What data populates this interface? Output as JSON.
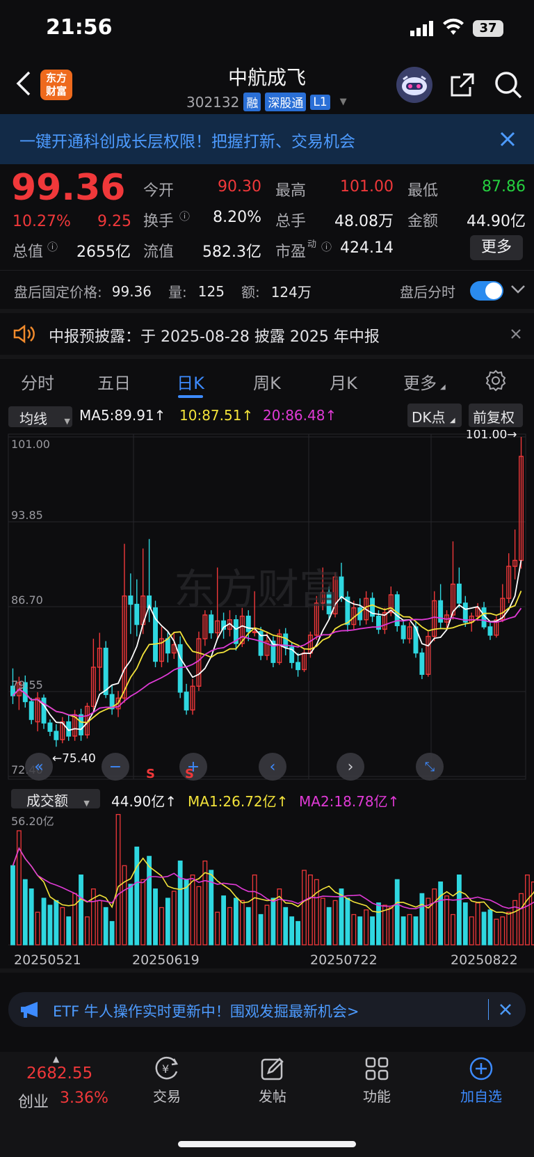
{
  "status_bar": {
    "time": "21:56",
    "battery": "37"
  },
  "header": {
    "title": "中航成飞",
    "code": "302132",
    "tags": [
      "融",
      "深股通",
      "L1"
    ],
    "logo_text": [
      "东方",
      "财富"
    ]
  },
  "banner": {
    "text": "一键开通科创成长层权限！把握打新、交易机会"
  },
  "quote": {
    "price": "99.36",
    "change_pct": "10.27%",
    "change_amt": "9.25",
    "rows": [
      [
        {
          "label": "今开",
          "value": "90.30",
          "color": "red"
        },
        {
          "label": "最高",
          "value": "101.00",
          "color": "red"
        },
        {
          "label": "最低",
          "value": "87.86",
          "color": "green"
        }
      ],
      [
        {
          "label": "换手",
          "value": "8.20%",
          "color": "white"
        },
        {
          "label": "总手",
          "value": "48.08万",
          "color": "white"
        },
        {
          "label": "金额",
          "value": "44.90亿",
          "color": "white"
        }
      ],
      [
        {
          "label": "流值",
          "value": "582.3亿",
          "color": "white"
        },
        {
          "label": "市盈",
          "value": "424.14",
          "color": "white"
        }
      ]
    ],
    "total_value_label": "总值",
    "total_value": "2655亿",
    "pe_sup": "动",
    "more_label": "更多"
  },
  "after_hours": {
    "price_label": "盘后固定价格:",
    "price": "99.36",
    "vol_label": "量:",
    "vol": "125",
    "amt_label": "额:",
    "amt": "124万",
    "timeshare_label": "盘后分时"
  },
  "notice": {
    "text": "中报预披露：于 2025-08-28 披露 2025 年中报"
  },
  "tabs": [
    "分时",
    "五日",
    "日K",
    "周K",
    "月K",
    "更多"
  ],
  "active_tab": "日K",
  "ma_bar": {
    "selector": "均线",
    "ma5": "MA5:89.91↑",
    "ma10": "10:87.51↑",
    "ma20": "20:86.48↑",
    "dk": "DK点",
    "adjust": "前复权"
  },
  "chart_data": [
    {
      "type": "candlestick",
      "y_ticks": [
        "101.00",
        "93.85",
        "86.70",
        "79.55",
        "72.40"
      ],
      "ylim": [
        72.4,
        101.0
      ],
      "annotations": [
        "101.00→",
        "←75.40"
      ],
      "series_colors": {
        "up": "#f0383a",
        "down": "#2fd7e0",
        "ma5": "#ffffff",
        "ma10": "#f3e33a",
        "ma20": "#e03ad6"
      },
      "marks": [
        "S",
        "S"
      ],
      "candles": [
        [
          80.0,
          81.5,
          78.5,
          79.2
        ],
        [
          79.2,
          80.8,
          78.0,
          80.3
        ],
        [
          80.3,
          80.9,
          78.2,
          78.7
        ],
        [
          78.7,
          79.0,
          76.8,
          77.2
        ],
        [
          77.0,
          79.5,
          76.2,
          79.0
        ],
        [
          79.0,
          79.3,
          76.4,
          76.9
        ],
        [
          76.9,
          77.2,
          75.8,
          76.2
        ],
        [
          76.2,
          76.8,
          74.9,
          75.5
        ],
        [
          75.5,
          77.4,
          75.2,
          77.0
        ],
        [
          77.0,
          77.6,
          75.4,
          75.8
        ],
        [
          75.8,
          78.0,
          75.4,
          77.6
        ],
        [
          77.6,
          78.1,
          75.4,
          75.9
        ],
        [
          75.9,
          78.6,
          75.6,
          78.3
        ],
        [
          78.3,
          84.0,
          78.0,
          81.6
        ],
        [
          81.6,
          84.5,
          79.6,
          83.2
        ],
        [
          83.2,
          83.8,
          79.0,
          79.3
        ],
        [
          79.3,
          80.1,
          77.6,
          78.1
        ],
        [
          78.1,
          79.6,
          77.4,
          79.0
        ],
        [
          79.0,
          92.0,
          78.6,
          87.6
        ],
        [
          87.6,
          89.5,
          84.4,
          86.9
        ],
        [
          86.9,
          89.0,
          84.2,
          85.2
        ],
        [
          85.2,
          91.6,
          84.4,
          87.6
        ],
        [
          87.6,
          92.4,
          85.4,
          86.6
        ],
        [
          86.6,
          87.2,
          81.6,
          82.1
        ],
        [
          82.1,
          85.0,
          81.6,
          84.0
        ],
        [
          84.0,
          84.6,
          82.0,
          82.8
        ],
        [
          82.8,
          84.5,
          82.3,
          83.5
        ],
        [
          83.5,
          84.2,
          79.0,
          79.5
        ],
        [
          79.5,
          80.2,
          77.6,
          78.0
        ],
        [
          78.0,
          80.6,
          77.6,
          80.0
        ],
        [
          80.0,
          84.6,
          79.6,
          84.0
        ],
        [
          84.0,
          86.4,
          83.4,
          86.0
        ],
        [
          86.0,
          86.4,
          84.0,
          84.5
        ],
        [
          84.5,
          90.0,
          84.0,
          85.5
        ],
        [
          85.5,
          86.2,
          84.0,
          84.8
        ],
        [
          84.8,
          86.4,
          84.2,
          85.6
        ],
        [
          85.6,
          86.0,
          83.0,
          83.6
        ],
        [
          83.6,
          86.6,
          83.3,
          85.9
        ],
        [
          85.9,
          86.4,
          83.8,
          84.6
        ],
        [
          84.6,
          88.0,
          84.2,
          84.6
        ],
        [
          84.6,
          85.0,
          82.2,
          82.6
        ],
        [
          82.6,
          84.6,
          82.2,
          83.8
        ],
        [
          83.8,
          84.2,
          81.6,
          82.0
        ],
        [
          82.0,
          84.8,
          81.8,
          84.4
        ],
        [
          84.4,
          84.9,
          82.6,
          83.3
        ],
        [
          83.3,
          83.7,
          81.5,
          82.0
        ],
        [
          82.0,
          82.8,
          80.8,
          81.4
        ],
        [
          81.4,
          83.2,
          81.2,
          82.8
        ],
        [
          82.8,
          84.6,
          82.4,
          84.3
        ],
        [
          84.3,
          87.6,
          83.9,
          87.0
        ],
        [
          87.0,
          90.0,
          86.4,
          87.9
        ],
        [
          87.9,
          88.4,
          85.6,
          86.1
        ],
        [
          86.1,
          89.6,
          85.8,
          89.2
        ],
        [
          89.2,
          90.4,
          87.1,
          87.5
        ],
        [
          87.5,
          88.0,
          84.6,
          85.2
        ],
        [
          85.2,
          87.2,
          84.8,
          86.6
        ],
        [
          86.6,
          87.4,
          85.1,
          85.6
        ],
        [
          85.6,
          88.0,
          85.2,
          87.4
        ],
        [
          87.4,
          87.9,
          85.4,
          85.9
        ],
        [
          85.9,
          86.4,
          84.4,
          84.8
        ],
        [
          84.8,
          86.6,
          84.4,
          86.2
        ],
        [
          86.2,
          88.4,
          85.9,
          87.7
        ],
        [
          87.7,
          88.0,
          84.6,
          85.1
        ],
        [
          85.1,
          85.6,
          83.6,
          84.0
        ],
        [
          84.0,
          85.4,
          83.6,
          85.0
        ],
        [
          85.0,
          85.4,
          82.4,
          82.8
        ],
        [
          82.8,
          83.2,
          80.6,
          81.0
        ],
        [
          81.0,
          84.6,
          80.8,
          84.2
        ],
        [
          84.2,
          88.0,
          83.8,
          87.2
        ],
        [
          87.2,
          88.6,
          84.8,
          85.4
        ],
        [
          85.4,
          86.4,
          84.8,
          86.0
        ],
        [
          86.0,
          92.2,
          85.6,
          88.6
        ],
        [
          88.6,
          90.0,
          86.6,
          87.0
        ],
        [
          87.0,
          87.6,
          85.0,
          85.4
        ],
        [
          85.4,
          86.2,
          84.6,
          85.9
        ],
        [
          85.9,
          87.0,
          85.5,
          86.6
        ],
        [
          86.6,
          87.1,
          84.8,
          85.0
        ],
        [
          85.0,
          85.4,
          83.9,
          84.3
        ],
        [
          84.3,
          85.9,
          84.1,
          85.6
        ],
        [
          85.6,
          88.6,
          85.4,
          87.4
        ],
        [
          87.4,
          91.2,
          87.0,
          90.1
        ],
        [
          90.1,
          93.2,
          89.0,
          90.6
        ],
        [
          90.6,
          101.0,
          89.9,
          99.36
        ]
      ]
    },
    {
      "type": "bar",
      "title": "成交额",
      "y_max_label": "56.20亿",
      "ylim": [
        0,
        56.2
      ],
      "x_tick_labels": [
        "20250521",
        "20250619",
        "20250722",
        "20250822"
      ],
      "values": [
        34,
        49,
        28,
        24,
        14,
        20,
        17,
        19,
        16,
        12,
        22,
        30,
        12,
        24,
        19,
        16,
        10,
        56,
        34,
        26,
        42,
        28,
        38,
        24,
        16,
        20,
        23,
        36,
        28,
        30,
        25,
        36,
        32,
        14,
        21,
        16,
        20,
        19,
        16,
        30,
        13,
        17,
        20,
        24,
        16,
        12,
        10,
        32,
        30,
        28,
        20,
        16,
        19,
        24,
        20,
        13,
        12,
        15,
        12,
        18,
        17,
        16,
        28,
        12,
        13,
        12,
        22,
        20,
        24,
        27,
        21,
        13,
        30,
        18,
        12,
        18,
        14,
        15,
        11,
        12,
        14,
        19,
        22,
        30,
        27,
        36,
        37,
        24,
        45
      ],
      "ma1_label": "44.90亿↑",
      "ma1": "MA1:26.72亿↑",
      "ma2": "MA2:18.78亿↑",
      "selector": "成交额"
    }
  ],
  "etf_banner": {
    "text": "ETF 牛人操作实时更新中！围观发掘最新机会>"
  },
  "bottom_nav": {
    "index_value": "2682.55",
    "index_name": "创业",
    "index_change": "3.36%",
    "items": [
      "交易",
      "发帖",
      "功能",
      "加自选"
    ]
  },
  "colors": {
    "accent": "#3d8bff",
    "up": "#f0383a",
    "down": "#2fd7e0",
    "banner_bg": "#122a47"
  }
}
